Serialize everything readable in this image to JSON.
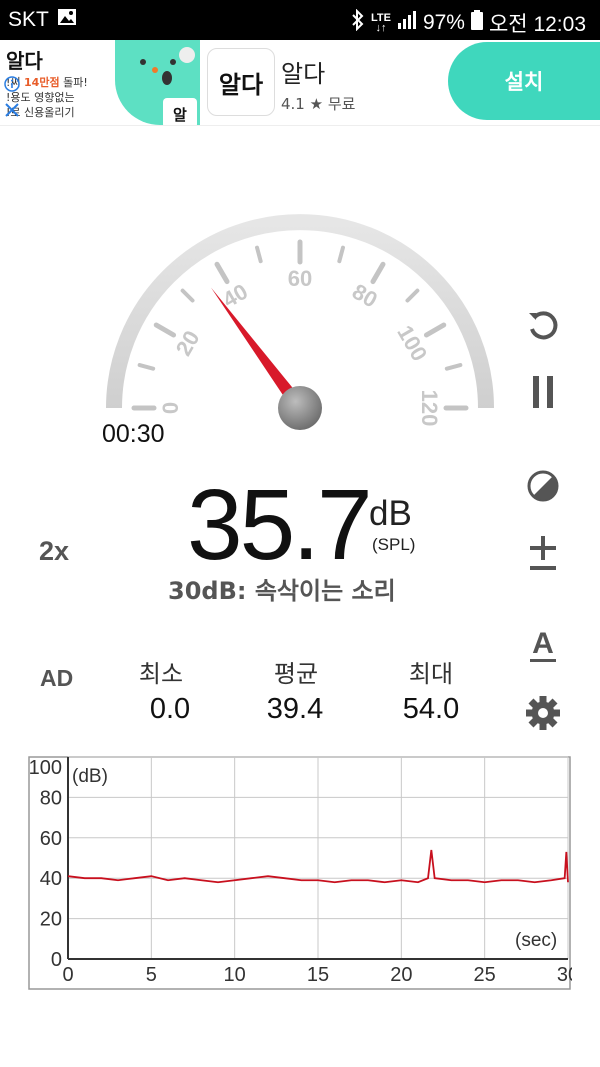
{
  "status_bar": {
    "carrier": "SKT",
    "network": "LTE",
    "battery": "97%",
    "time": "오전 12:03",
    "icons": [
      "image-icon",
      "bluetooth-icon",
      "lte-icon",
      "signal-icon",
      "battery-icon"
    ]
  },
  "ad": {
    "brand": "알다",
    "line1_pre": "!써 ",
    "line1_highlight": "14만점",
    "line1_post": " 돌파!",
    "line2": "!용도 영향없는",
    "line3": "!로 신용올리기",
    "mascot_badge": "알",
    "app_icon_text": "알다",
    "app_name": "알다",
    "rating": "4.1",
    "rating_star": "★",
    "price": "무료",
    "install_label": "설치",
    "accent_color": "#3fd7bd"
  },
  "gauge": {
    "ticks": [
      "0",
      "20",
      "40",
      "60",
      "80",
      "100",
      "120"
    ],
    "min": 0,
    "max": 120,
    "needle_value": 35.7,
    "needle_color": "#d8192a"
  },
  "timer": "00:30",
  "reading": {
    "value": "35.7",
    "unit": "dB",
    "unit_sub": "(SPL)",
    "description": "30dB: 속삭이는 소리"
  },
  "controls": {
    "multiplier": "2x",
    "ad_toggle": "AD",
    "icons": [
      "reset-icon",
      "pause-icon",
      "theme-icon",
      "calibrate-icon",
      "a-weighting-icon",
      "settings-icon"
    ]
  },
  "stats": {
    "min_label": "최소",
    "min_value": "0.0",
    "avg_label": "평균",
    "avg_value": "39.4",
    "max_label": "최대",
    "max_value": "54.0"
  },
  "chart_data": {
    "type": "line",
    "xlabel": "(sec)",
    "ylabel": "(dB)",
    "xlim": [
      0,
      30
    ],
    "ylim": [
      0,
      100
    ],
    "x_ticks": [
      "0",
      "5",
      "10",
      "15",
      "20",
      "25",
      "30"
    ],
    "y_ticks": [
      "0",
      "20",
      "40",
      "60",
      "80",
      "100"
    ],
    "grid": true,
    "series": [
      {
        "color": "#c8101e",
        "x": [
          0,
          1,
          2,
          3,
          4,
          5,
          6,
          7,
          8,
          9,
          10,
          11,
          12,
          13,
          14,
          15,
          16,
          17,
          18,
          19,
          20,
          21,
          21.6,
          21.8,
          22,
          23,
          24,
          25,
          26,
          27,
          28,
          29,
          29.8,
          29.9,
          30
        ],
        "y": [
          41,
          40,
          40,
          39,
          40,
          41,
          39,
          40,
          39,
          38,
          39,
          40,
          41,
          40,
          39,
          39,
          38,
          39,
          39,
          38,
          39,
          38,
          40,
          54,
          40,
          39,
          39,
          38,
          39,
          39,
          38,
          39,
          40,
          53,
          38
        ]
      }
    ]
  }
}
